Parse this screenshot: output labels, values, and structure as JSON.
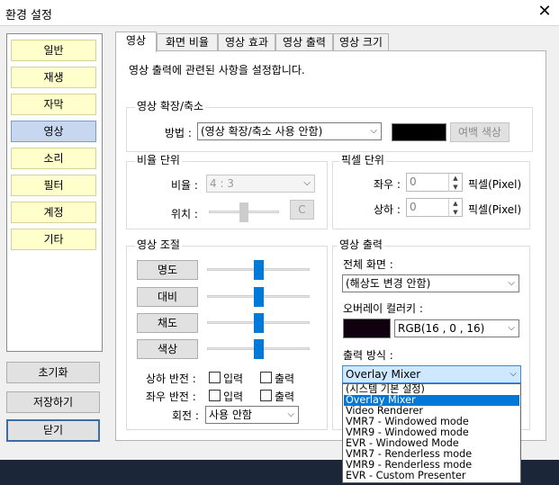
{
  "window": {
    "title": "환경 설정"
  },
  "sidebar": {
    "categories": [
      "일반",
      "재생",
      "자막",
      "영상",
      "소리",
      "필터",
      "계정",
      "기타"
    ],
    "selected": "영상"
  },
  "buttons": {
    "reset": "초기화",
    "save": "저장하기",
    "close": "닫기"
  },
  "tabs": [
    "영상",
    "화면 비율",
    "영상 효과",
    "영상 출력",
    "영상 크기"
  ],
  "description": "영상 출력에 관련된 사항을 설정합니다.",
  "scale": {
    "group_label": "영상 확장/축소",
    "method_label": "방법 :",
    "method_value": "(영상 확장/축소 사용 안함)",
    "margin_color_button": "여백 색상",
    "margin_color": "#000000"
  },
  "aspect": {
    "group_label": "비율 단위",
    "ratio_label": "비율 :",
    "ratio_value": "4 : 3",
    "position_label": "위치 :",
    "c_button": "C",
    "position_level": 0.5
  },
  "pixel": {
    "group_label": "픽셀 단위",
    "horizontal_label": "좌우 :",
    "horizontal_value": "0",
    "vertical_label": "상하 :",
    "vertical_value": "0",
    "unit_label": "픽셀(Pixel)"
  },
  "adjust": {
    "group_label": "영상 조절",
    "sliders": [
      {
        "label": "명도",
        "level": 0.5
      },
      {
        "label": "대비",
        "level": 0.5
      },
      {
        "label": "채도",
        "level": 0.5
      },
      {
        "label": "색상",
        "level": 0.5
      }
    ],
    "flip_v_label": "상하 반전 :",
    "flip_h_label": "좌우 반전 :",
    "input_label": "입력",
    "output_label": "출력",
    "rotate_label": "회전 :",
    "rotate_value": "사용 안함"
  },
  "output": {
    "group_label": "영상 출력",
    "fullscreen_label": "전체 화면 :",
    "fullscreen_value": "(해상도 변경 안함)",
    "overlay_label": "오버레이 컬러키 :",
    "overlay_value": "RGB(16 , 0 , 16)",
    "overlay_color": "#100010",
    "method_label": "출력 방식 :",
    "method_value": "Overlay Mixer",
    "options": [
      "(시스템 기본 설정)",
      "Overlay Mixer",
      "Video Renderer",
      "VMR7 - Windowed mode",
      "VMR9 - Windowed mode",
      "EVR - Windowed Mode",
      "VMR7 - Renderless mode",
      "VMR9 - Renderless mode",
      "EVR - Custom Presenter"
    ],
    "selected_option_index": 1
  },
  "accent": "#0078d7"
}
